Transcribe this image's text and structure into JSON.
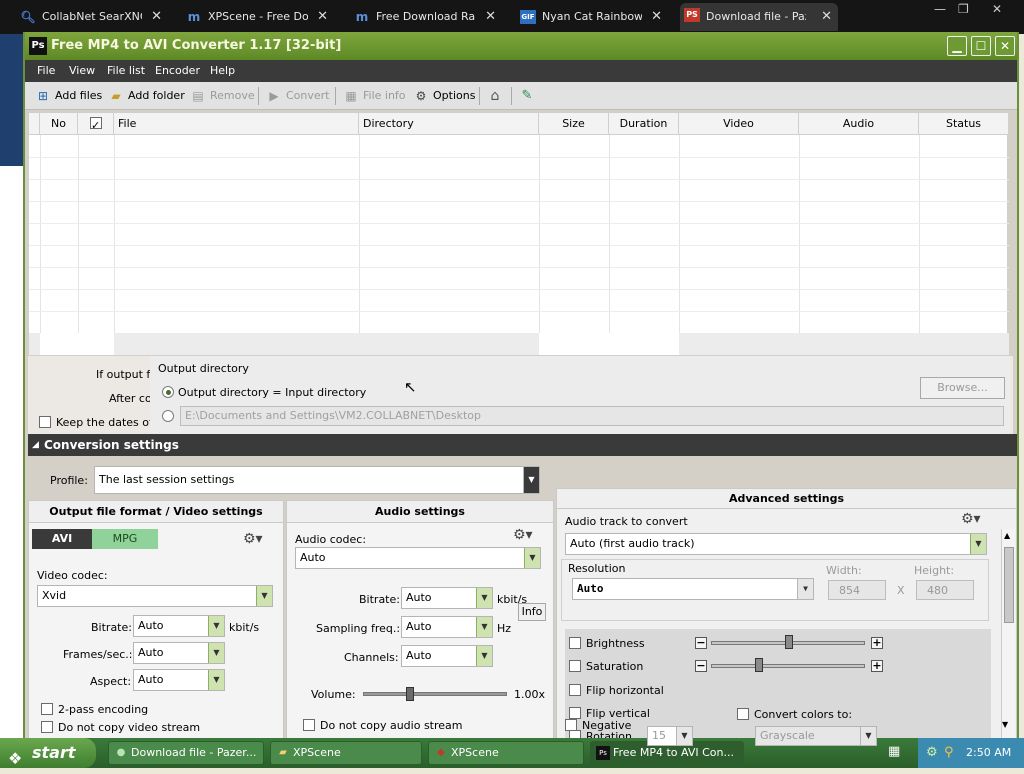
{
  "browser": {
    "tabs": [
      {
        "title": "CollabNet SearXNG",
        "icon": "search-icon"
      },
      {
        "title": "XPScene - Free Dow",
        "icon": "xpscene-icon"
      },
      {
        "title": "Free Download Rain",
        "icon": "xpscene-icon"
      },
      {
        "title": "Nyan Cat Rainbow G",
        "icon": "gif-icon"
      },
      {
        "title": "Download file - Paze",
        "icon": "ps-icon"
      }
    ],
    "window_controls": {
      "minimize": "—",
      "restore": "❐",
      "close": "✕"
    }
  },
  "app": {
    "title": "Free MP4 to AVI Converter 1.17  [32-bit]",
    "menu": [
      "File",
      "View",
      "File list",
      "Encoder",
      "Help"
    ],
    "toolbar": {
      "add_files": "Add files",
      "add_folder": "Add folder",
      "remove": "Remove",
      "convert": "Convert",
      "file_info": "File info",
      "options": "Options"
    },
    "table": {
      "headers": [
        "No",
        "",
        "File",
        "Directory",
        "Size",
        "Duration",
        "Video",
        "Audio",
        "Status"
      ]
    },
    "output": {
      "if_output_label": "If output f",
      "after_label": "After co",
      "keep_dates_label": "Keep the dates of",
      "popup_title": "Output directory",
      "option_input_dir": "Output directory = Input directory",
      "path": "E:\\Documents and Settings\\VM2.COLLABNET\\Desktop",
      "browse": "Browse..."
    },
    "conversion": {
      "header": "Conversion settings",
      "profile_label": "Profile:",
      "profile_value": "The last session settings",
      "video": {
        "header": "Output file format / Video settings",
        "tab_avi": "AVI",
        "tab_mpg": "MPG",
        "codec_label": "Video codec:",
        "codec_value": "Xvid",
        "bitrate_label": "Bitrate:",
        "bitrate_value": "Auto",
        "bitrate_unit": "kbit/s",
        "fps_label": "Frames/sec.:",
        "fps_value": "Auto",
        "aspect_label": "Aspect:",
        "aspect_value": "Auto",
        "two_pass": "2-pass encoding",
        "no_copy_video": "Do not copy video stream"
      },
      "audio": {
        "header": "Audio settings",
        "codec_label": "Audio codec:",
        "codec_value": "Auto",
        "bitrate_label": "Bitrate:",
        "bitrate_value": "Auto",
        "bitrate_unit": "kbit/s",
        "info": "Info",
        "sampling_label": "Sampling freq.:",
        "sampling_value": "Auto",
        "sampling_unit": "Hz",
        "channels_label": "Channels:",
        "channels_value": "Auto",
        "volume_label": "Volume:",
        "volume_value": "1.00x",
        "no_copy_audio": "Do not copy audio stream"
      },
      "advanced": {
        "header": "Advanced settings",
        "audio_track_label": "Audio track to convert",
        "audio_track_value": "Auto (first audio track)",
        "resolution_label": "Resolution",
        "resolution_value": "Auto",
        "width_label": "Width:",
        "width_value": "854",
        "height_label": "Height:",
        "height_value": "480",
        "x_sep": "X",
        "brightness": "Brightness",
        "saturation": "Saturation",
        "flip_h": "Flip horizontal",
        "flip_v": "Flip vertical",
        "rotation": "Rotation",
        "rotation_value": "15",
        "negative": "Negative",
        "convert_colors": "Convert colors to:",
        "convert_colors_value": "Grayscale"
      }
    }
  },
  "taskbar": {
    "start": "start",
    "tasks": [
      "Download file - Pazer...",
      "XPScene",
      "XPScene",
      "Free MP4 to AVI Con..."
    ],
    "clock": "2:50 AM"
  }
}
